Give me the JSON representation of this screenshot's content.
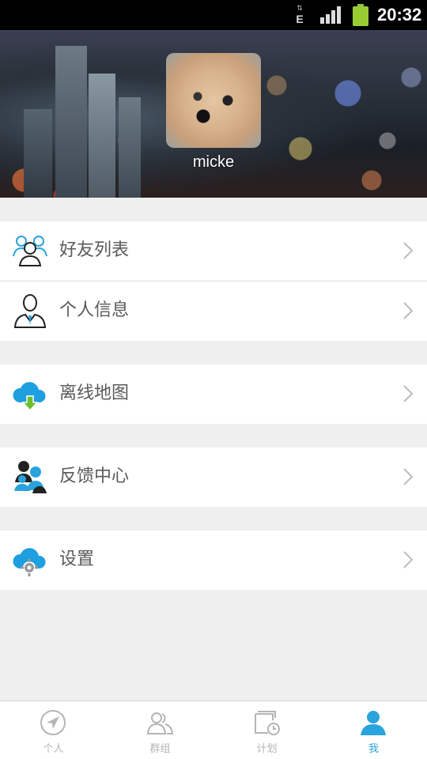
{
  "status_bar": {
    "network_type": "E",
    "time": "20:32"
  },
  "profile": {
    "username": "micke"
  },
  "menu": {
    "items": [
      {
        "label": "好友列表",
        "icon": "friends-icon"
      },
      {
        "label": "个人信息",
        "icon": "person-info-icon"
      },
      {
        "label": "离线地图",
        "icon": "cloud-download-icon"
      },
      {
        "label": "反馈中心",
        "icon": "feedback-icon"
      },
      {
        "label": "设置",
        "icon": "cloud-settings-icon"
      }
    ]
  },
  "tabs": [
    {
      "label": "个人",
      "icon": "navigation-arrow-icon",
      "active": false
    },
    {
      "label": "群组",
      "icon": "group-icon",
      "active": false
    },
    {
      "label": "计划",
      "icon": "calendar-clock-icon",
      "active": false
    },
    {
      "label": "我",
      "icon": "user-icon",
      "active": true
    }
  ],
  "colors": {
    "accent": "#2aa4dc",
    "inactive_tab": "#b5b5b5",
    "background": "#efefef"
  }
}
